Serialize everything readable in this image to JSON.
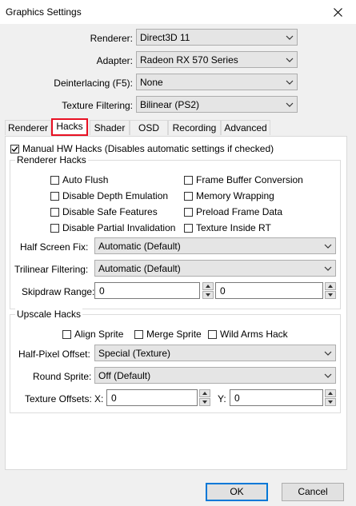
{
  "window": {
    "title": "Graphics Settings"
  },
  "top_settings": {
    "renderer": {
      "label": "Renderer:",
      "value": "Direct3D 11"
    },
    "adapter": {
      "label": "Adapter:",
      "value": "Radeon RX 570 Series"
    },
    "deinterlacing": {
      "label": "Deinterlacing (F5):",
      "value": "None"
    },
    "texture_filtering": {
      "label": "Texture Filtering:",
      "value": "Bilinear (PS2)"
    }
  },
  "tabs": [
    {
      "label": "Renderer",
      "active": false
    },
    {
      "label": "Hacks",
      "active": true
    },
    {
      "label": "Shader",
      "active": false
    },
    {
      "label": "OSD",
      "active": false
    },
    {
      "label": "Recording",
      "active": false
    },
    {
      "label": "Advanced",
      "active": false
    }
  ],
  "hacks": {
    "manual_hw_hacks": {
      "label": "Manual HW Hacks (Disables automatic settings if checked)",
      "checked": true
    },
    "renderer_hacks": {
      "title": "Renderer Hacks",
      "checks": [
        {
          "label": "Auto Flush",
          "checked": false
        },
        {
          "label": "Frame Buffer Conversion",
          "checked": false
        },
        {
          "label": "Disable Depth Emulation",
          "checked": false
        },
        {
          "label": "Memory Wrapping",
          "checked": false
        },
        {
          "label": "Disable Safe Features",
          "checked": false
        },
        {
          "label": "Preload Frame Data",
          "checked": false
        },
        {
          "label": "Disable Partial Invalidation",
          "checked": false
        },
        {
          "label": "Texture Inside RT",
          "checked": false
        }
      ],
      "half_screen_fix": {
        "label": "Half Screen Fix:",
        "value": "Automatic (Default)"
      },
      "trilinear_filtering": {
        "label": "Trilinear Filtering:",
        "value": "Automatic (Default)"
      },
      "skipdraw_range": {
        "label": "Skipdraw Range:",
        "start": "0",
        "end": "0"
      }
    },
    "upscale_hacks": {
      "title": "Upscale Hacks",
      "checks": [
        {
          "label": "Align Sprite",
          "checked": false
        },
        {
          "label": "Merge Sprite",
          "checked": false
        },
        {
          "label": "Wild Arms Hack",
          "checked": false
        }
      ],
      "half_pixel_offset": {
        "label": "Half-Pixel Offset:",
        "value": "Special (Texture)"
      },
      "round_sprite": {
        "label": "Round Sprite:",
        "value": "Off (Default)"
      },
      "texture_offsets": {
        "label": "Texture Offsets:",
        "x_label": "X:",
        "x": "0",
        "y_label": "Y:",
        "y": "0"
      }
    }
  },
  "buttons": {
    "ok": "OK",
    "cancel": "Cancel"
  },
  "colors": {
    "highlight": "#e81123",
    "accent": "#0078d7"
  }
}
